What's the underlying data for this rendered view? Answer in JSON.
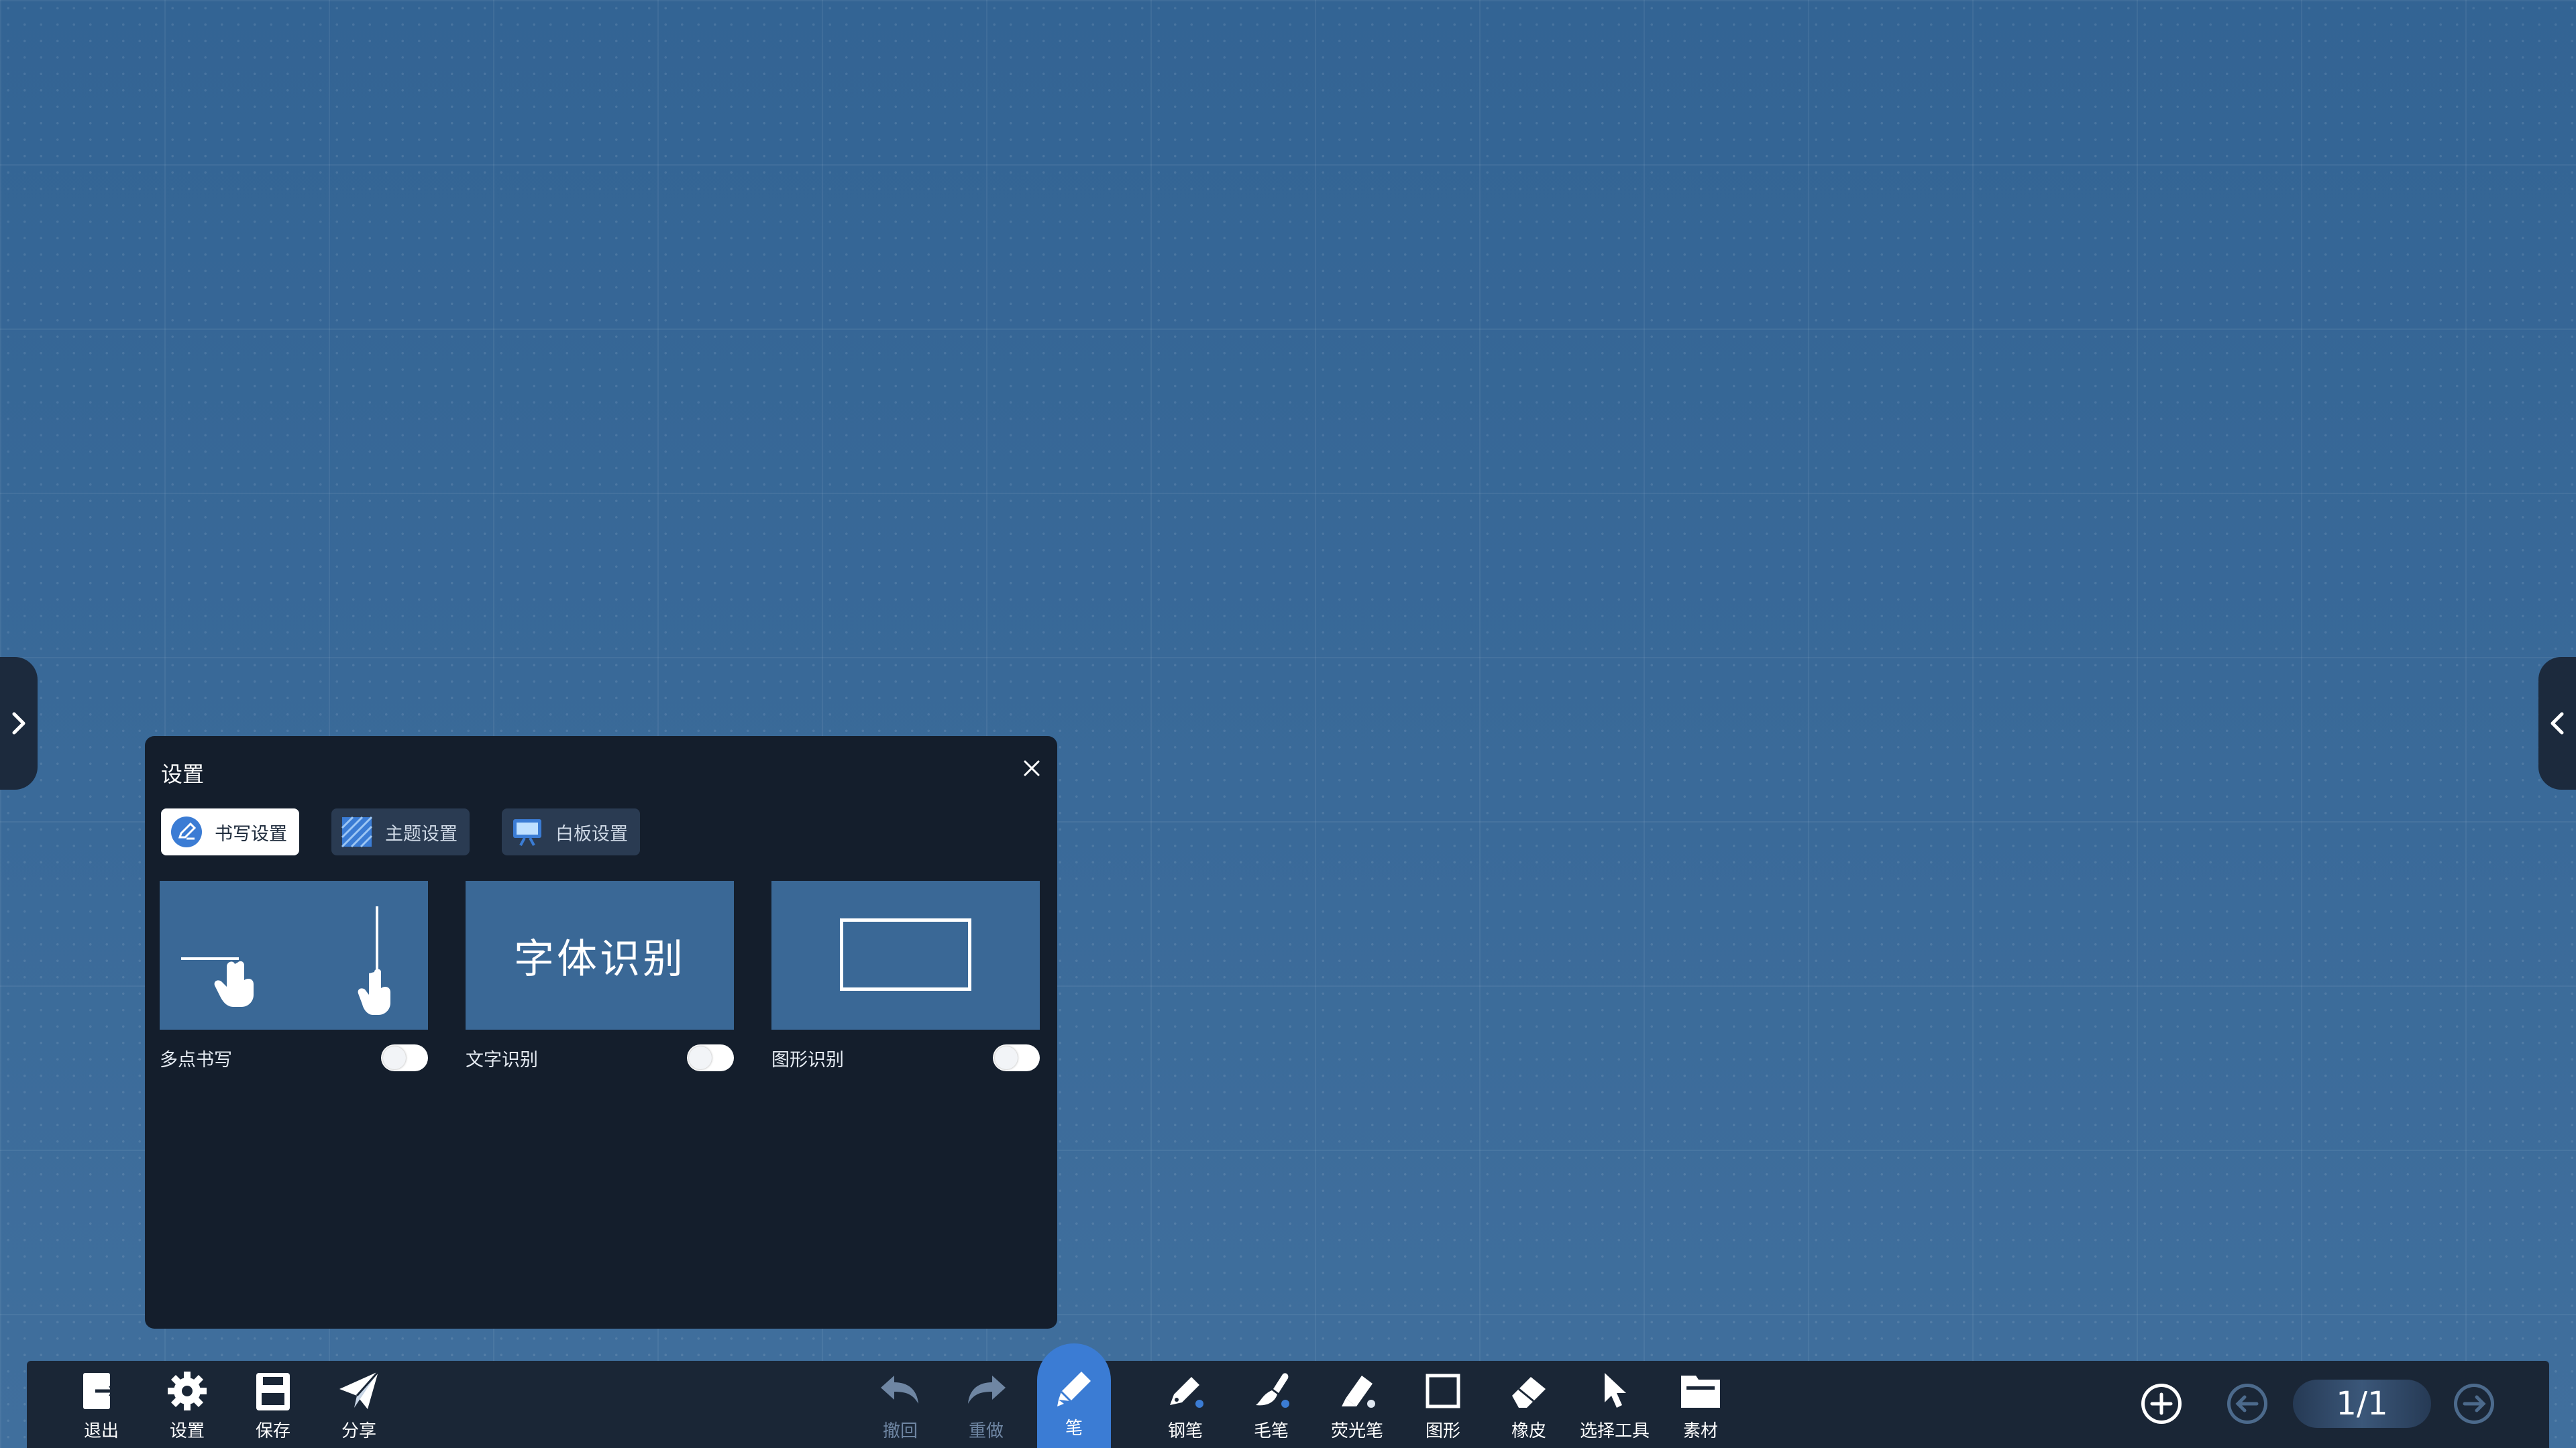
{
  "panel": {
    "title": "设置",
    "tabs": [
      {
        "label": "书写设置",
        "icon": "pen-circle-icon",
        "active": true
      },
      {
        "label": "主题设置",
        "icon": "theme-stripes-icon",
        "active": false
      },
      {
        "label": "白板设置",
        "icon": "whiteboard-icon",
        "active": false
      }
    ],
    "cards": [
      {
        "label": "多点书写",
        "preview": "multi-touch-hands",
        "enabled": false
      },
      {
        "label": "文字识别",
        "preview_text": "字体识别",
        "enabled": false
      },
      {
        "label": "图形识别",
        "preview": "rectangle",
        "enabled": false
      }
    ]
  },
  "toolbar": {
    "left": [
      {
        "label": "退出",
        "icon": "exit-icon"
      },
      {
        "label": "设置",
        "icon": "gear-icon"
      },
      {
        "label": "保存",
        "icon": "save-icon"
      },
      {
        "label": "分享",
        "icon": "share-icon"
      }
    ],
    "center": [
      {
        "label": "撤回",
        "icon": "undo-icon",
        "enabled": false
      },
      {
        "label": "重做",
        "icon": "redo-icon",
        "enabled": false
      },
      {
        "label": "笔",
        "icon": "pen-icon",
        "active": true
      },
      {
        "label": "钢笔",
        "icon": "fountain-pen-icon"
      },
      {
        "label": "毛笔",
        "icon": "brush-icon"
      },
      {
        "label": "荧光笔",
        "icon": "highlighter-icon"
      },
      {
        "label": "图形",
        "icon": "shape-icon"
      },
      {
        "label": "橡皮",
        "icon": "eraser-icon"
      },
      {
        "label": "选择工具",
        "icon": "select-cursor-icon"
      },
      {
        "label": "素材",
        "icon": "folder-icon"
      }
    ],
    "page_indicator": "1/1"
  },
  "colors": {
    "board_background": "#3a6a99",
    "panel_background": "#141e2c",
    "toolbar_background": "#1a2636",
    "accent": "#3b7cd4"
  }
}
